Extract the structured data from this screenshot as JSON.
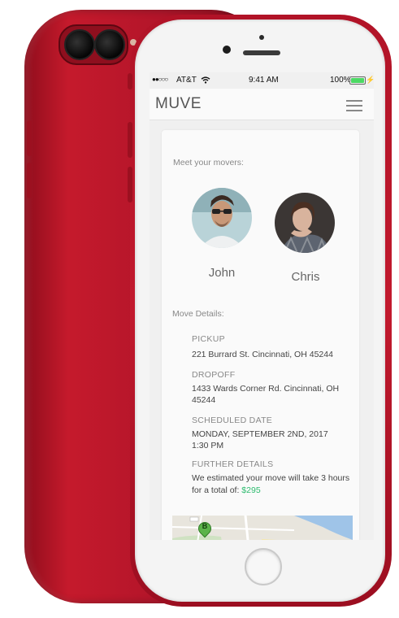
{
  "status_bar": {
    "signal": "●●○○○",
    "carrier": "AT&T",
    "time": "9:41 AM",
    "battery": "100%"
  },
  "header": {
    "app_title": "MUVE"
  },
  "movers": {
    "section_label": "Meet your movers:",
    "list": [
      {
        "name": "John"
      },
      {
        "name": "Chris"
      }
    ]
  },
  "details": {
    "section_label": "Move Details:",
    "pickup": {
      "label": "PICKUP",
      "value": "221 Burrard St. Cincinnati, OH 45244"
    },
    "dropoff": {
      "label": "DROPOFF",
      "value_line1": "1433 Wards Corner Rd. Cincinnati, OH",
      "value_line2": "45244"
    },
    "scheduled": {
      "label": "SCHEDULED DATE",
      "date": "MONDAY, SEPTEMBER 2ND, 2017",
      "time": "1:30 PM"
    },
    "further": {
      "label": "FURTHER DETAILS",
      "line1": "We estimated your move will take 3 hours",
      "line2_prefix": "for a total of: ",
      "price": "$295"
    }
  },
  "map": {
    "marker_label": "B"
  },
  "colors": {
    "phone_red": "#c21a2e",
    "price_green": "#2dbb6e",
    "battery_green": "#4cd964"
  }
}
